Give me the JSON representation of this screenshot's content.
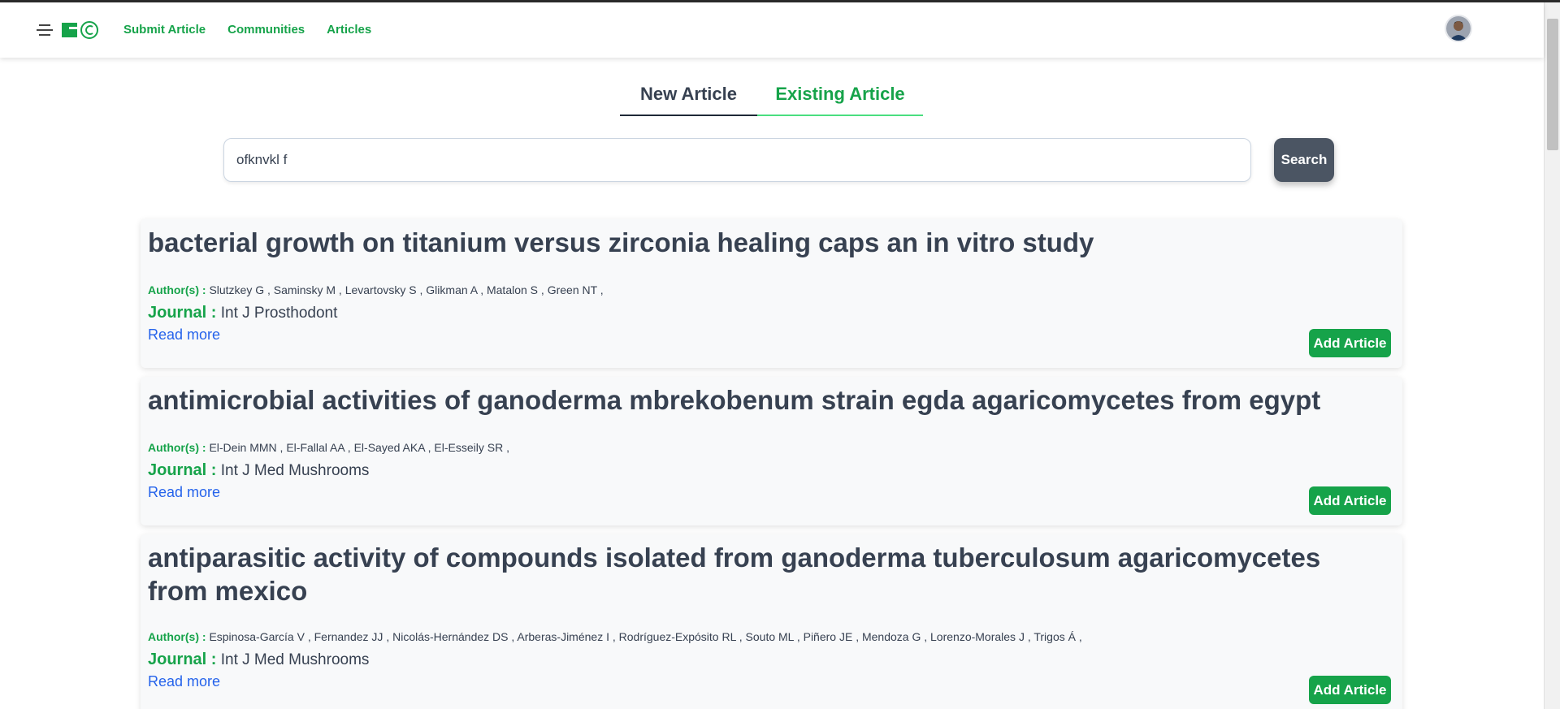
{
  "nav": {
    "links": [
      "Submit Article",
      "Communities",
      "Articles"
    ]
  },
  "tabs": {
    "new_label": "New Article",
    "existing_label": "Existing Article"
  },
  "search": {
    "value": "ofknvkl f",
    "button_label": "Search"
  },
  "articles": [
    {
      "title": "bacterial growth on titanium versus zirconia healing caps an in vitro study",
      "authors_label": "Author(s) :",
      "authors": "Slutzkey G , Saminsky M , Levartovsky S , Glikman A , Matalon S , Green NT ,",
      "journal_label": "Journal :",
      "journal": "Int J Prosthodont",
      "read_more": "Read more",
      "add_label": "Add Article"
    },
    {
      "title": "antimicrobial activities of ganoderma mbrekobenum strain egda agaricomycetes from egypt",
      "authors_label": "Author(s) :",
      "authors": "El-Dein MMN , El-Fallal AA , El-Sayed AKA , El-Esseily SR ,",
      "journal_label": "Journal :",
      "journal": "Int J Med Mushrooms",
      "read_more": "Read more",
      "add_label": "Add Article"
    },
    {
      "title": "antiparasitic activity of compounds isolated from ganoderma tuberculosum agaricomycetes from mexico",
      "authors_label": "Author(s) :",
      "authors": "Espinosa-García V , Fernandez JJ , Nicolás-Hernández DS , Arberas-Jiménez I , Rodríguez-Expósito RL , Souto ML , Piñero JE , Mendoza G , Lorenzo-Morales J , Trigos Á ,",
      "journal_label": "Journal :",
      "journal": "Int J Med Mushrooms",
      "read_more": "Read more",
      "add_label": "Add Article"
    }
  ],
  "colors": {
    "accent_green": "#16a34a",
    "link_blue": "#2563eb",
    "search_button": "#4b5563"
  }
}
